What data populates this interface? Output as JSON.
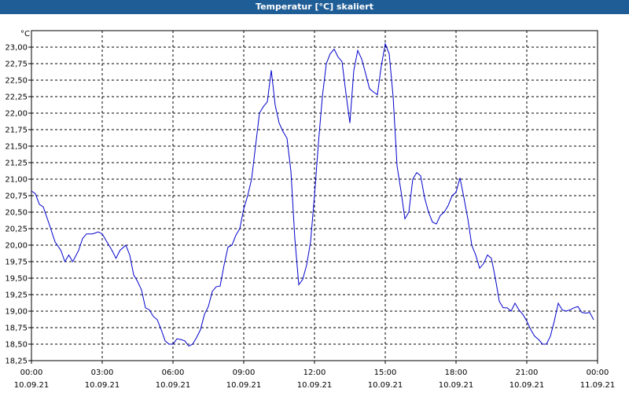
{
  "window": {
    "title": "Temperatur [°C] skaliert"
  },
  "chart_data": {
    "type": "line",
    "title": "Temperatur [°C] skaliert",
    "y_unit_label": "°C",
    "xlabel": "",
    "ylabel": "",
    "ylim": [
      18.25,
      23.25
    ],
    "y_ticks": [
      "18,25",
      "18,50",
      "18,75",
      "19,00",
      "19,25",
      "19,50",
      "19,75",
      "20,00",
      "20,25",
      "20,50",
      "20,75",
      "21,00",
      "21,25",
      "21,50",
      "21,75",
      "22,00",
      "22,25",
      "22,50",
      "22,75",
      "23,00"
    ],
    "x_ticks": [
      {
        "time": "00:00",
        "date": "10.09.21"
      },
      {
        "time": "03:00",
        "date": "10.09.21"
      },
      {
        "time": "06:00",
        "date": "10.09.21"
      },
      {
        "time": "09:00",
        "date": "10.09.21"
      },
      {
        "time": "12:00",
        "date": "10.09.21"
      },
      {
        "time": "15:00",
        "date": "10.09.21"
      },
      {
        "time": "18:00",
        "date": "10.09.21"
      },
      {
        "time": "21:00",
        "date": "10.09.21"
      },
      {
        "time": "00:00",
        "date": "11.09.21"
      }
    ],
    "grid": true,
    "series_color": "#0000cc",
    "series": [
      {
        "x": [
          "10.09.21 00:00",
          "10.09.21 00:10",
          "10.09.21 00:20",
          "10.09.21 00:30",
          "10.09.21 00:45",
          "10.09.21 01:00",
          "10.09.21 01:15",
          "10.09.21 01:25",
          "10.09.21 01:35",
          "10.09.21 01:45",
          "10.09.21 02:00",
          "10.09.21 02:10",
          "10.09.21 02:20",
          "10.09.21 02:35",
          "10.09.21 02:50",
          "10.09.21 03:00",
          "10.09.21 03:15",
          "10.09.21 03:25",
          "10.09.21 03:35",
          "10.09.21 03:45",
          "10.09.21 04:00",
          "10.09.21 04:10",
          "10.09.21 04:20",
          "10.09.21 04:30",
          "10.09.21 04:40",
          "10.09.21 04:50",
          "10.09.21 05:00",
          "10.09.21 05:10",
          "10.09.21 05:20",
          "10.09.21 05:30",
          "10.09.21 05:40",
          "10.09.21 05:50",
          "10.09.21 06:00",
          "10.09.21 06:10",
          "10.09.21 06:20",
          "10.09.21 06:30",
          "10.09.21 06:40",
          "10.09.21 06:50",
          "10.09.21 07:00",
          "10.09.21 07:10",
          "10.09.21 07:20",
          "10.09.21 07:30",
          "10.09.21 07:40",
          "10.09.21 07:50",
          "10.09.21 08:00",
          "10.09.21 08:10",
          "10.09.21 08:20",
          "10.09.21 08:30",
          "10.09.21 08:40",
          "10.09.21 08:50",
          "10.09.21 09:00",
          "10.09.21 09:10",
          "10.09.21 09:20",
          "10.09.21 09:30",
          "10.09.21 09:40",
          "10.09.21 09:50",
          "10.09.21 10:00",
          "10.09.21 10:10",
          "10.09.21 10:20",
          "10.09.21 10:30",
          "10.09.21 10:40",
          "10.09.21 10:50",
          "10.09.21 11:00",
          "10.09.21 11:10",
          "10.09.21 11:20",
          "10.09.21 11:30",
          "10.09.21 11:40",
          "10.09.21 11:50",
          "10.09.21 12:00",
          "10.09.21 12:10",
          "10.09.21 12:20",
          "10.09.21 12:30",
          "10.09.21 12:40",
          "10.09.21 12:50",
          "10.09.21 13:00",
          "10.09.21 13:10",
          "10.09.21 13:20",
          "10.09.21 13:30",
          "10.09.21 13:40",
          "10.09.21 13:50",
          "10.09.21 14:00",
          "10.09.21 14:10",
          "10.09.21 14:20",
          "10.09.21 14:30",
          "10.09.21 14:40",
          "10.09.21 14:50",
          "10.09.21 15:00",
          "10.09.21 15:10",
          "10.09.21 15:20",
          "10.09.21 15:30",
          "10.09.21 15:40",
          "10.09.21 15:50",
          "10.09.21 16:00",
          "10.09.21 16:10",
          "10.09.21 16:20",
          "10.09.21 16:30",
          "10.09.21 16:40",
          "10.09.21 16:50",
          "10.09.21 17:00",
          "10.09.21 17:10",
          "10.09.21 17:20",
          "10.09.21 17:30",
          "10.09.21 17:40",
          "10.09.21 17:50",
          "10.09.21 18:00",
          "10.09.21 18:10",
          "10.09.21 18:20",
          "10.09.21 18:30",
          "10.09.21 18:40",
          "10.09.21 18:50",
          "10.09.21 19:00",
          "10.09.21 19:10",
          "10.09.21 19:20",
          "10.09.21 19:30",
          "10.09.21 19:40",
          "10.09.21 19:50",
          "10.09.21 20:00",
          "10.09.21 20:10",
          "10.09.21 20:20",
          "10.09.21 20:30",
          "10.09.21 20:40",
          "10.09.21 20:50",
          "10.09.21 21:00",
          "10.09.21 21:10",
          "10.09.21 21:20",
          "10.09.21 21:30",
          "10.09.21 21:40",
          "10.09.21 21:50",
          "10.09.21 22:00",
          "10.09.21 22:10",
          "10.09.21 22:20",
          "10.09.21 22:30",
          "10.09.21 22:40",
          "10.09.21 22:50",
          "10.09.21 23:00",
          "10.09.21 23:10",
          "10.09.21 23:20",
          "10.09.21 23:30",
          "10.09.21 23:40",
          "10.09.21 23:50"
        ],
        "y": [
          20.82,
          20.78,
          20.62,
          20.58,
          20.32,
          20.05,
          19.92,
          19.75,
          19.85,
          19.75,
          19.92,
          20.1,
          20.17,
          20.17,
          20.2,
          20.17,
          20.02,
          19.92,
          19.8,
          19.92,
          20.0,
          19.85,
          19.55,
          19.45,
          19.32,
          19.05,
          19.02,
          18.92,
          18.87,
          18.72,
          18.55,
          18.5,
          18.5,
          18.58,
          18.57,
          18.55,
          18.47,
          18.5,
          18.6,
          18.72,
          18.95,
          19.07,
          19.3,
          19.37,
          19.38,
          19.7,
          19.97,
          20.0,
          20.15,
          20.25,
          20.55,
          20.75,
          21.0,
          21.5,
          22.0,
          22.1,
          22.17,
          22.65,
          22.12,
          21.85,
          21.72,
          21.62,
          21.12,
          20.1,
          19.4,
          19.48,
          19.7,
          20.05,
          20.75,
          21.55,
          22.25,
          22.75,
          22.9,
          22.97,
          22.85,
          22.78,
          22.3,
          21.85,
          22.65,
          22.95,
          22.82,
          22.6,
          22.37,
          22.32,
          22.28,
          22.72,
          23.05,
          22.9,
          22.25,
          21.2,
          20.82,
          20.4,
          20.5,
          21.0,
          21.1,
          21.05,
          20.72,
          20.5,
          20.35,
          20.32,
          20.45,
          20.5,
          20.6,
          20.75,
          20.8,
          21.02,
          20.72,
          20.4,
          20.0,
          19.85,
          19.65,
          19.72,
          19.85,
          19.8,
          19.5,
          19.15,
          19.05,
          19.05,
          19.0,
          19.12,
          19.02,
          18.95,
          18.85,
          18.72,
          18.62,
          18.57,
          18.5,
          18.5,
          18.62,
          18.85,
          19.12,
          19.02,
          19.0,
          19.02,
          19.05,
          19.07,
          18.98,
          18.97,
          18.98,
          18.87
        ]
      }
    ]
  }
}
